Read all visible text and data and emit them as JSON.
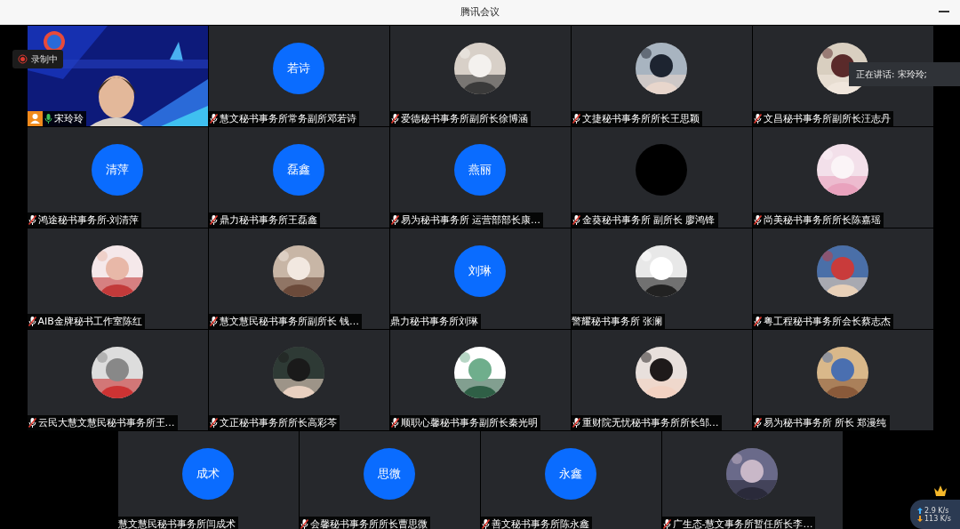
{
  "window": {
    "title": "腾讯会议"
  },
  "recording": {
    "label": "录制中"
  },
  "speaking": {
    "label": "正在讲话: 宋玲玲;"
  },
  "rows": [
    [
      {
        "kind": "video",
        "name": "宋玲玲",
        "mic_muted": false
      },
      {
        "kind": "initials",
        "initials": "若诗",
        "name": "慧文秘书事务所常务副所邓若诗",
        "mic_muted": true
      },
      {
        "name": "爱德秘书事务所副所长徐博涵",
        "mic_muted": true
      },
      {
        "name": "文捷秘书事务所所长王思颖",
        "mic_muted": true
      },
      {
        "name": "文昌秘书事务所副所长汪志丹",
        "mic_muted": true
      }
    ],
    [
      {
        "kind": "initials",
        "initials": "清萍",
        "name": "鸿途秘书事务所-刘清萍",
        "mic_muted": true
      },
      {
        "kind": "initials",
        "initials": "磊鑫",
        "name": "鼎力秘书事务所王磊鑫",
        "mic_muted": true
      },
      {
        "kind": "initials",
        "initials": "燕丽",
        "name": "易为秘书事务所 运营部部长康…",
        "mic_muted": true
      },
      {
        "kind": "blank",
        "name": "金葵秘书事务所 副所长 廖鸿锋",
        "mic_muted": true
      },
      {
        "name": "尚美秘书事务所所长陈嘉瑶",
        "mic_muted": true
      }
    ],
    [
      {
        "name": "AIB金牌秘书工作室陈红",
        "mic_muted": true
      },
      {
        "name": "慧文慧民秘书事务所副所长 钱…",
        "mic_muted": true
      },
      {
        "kind": "initials",
        "initials": "刘琳",
        "name": "鼎力秘书事务所刘琳"
      },
      {
        "name": "警耀秘书事务所  张澜"
      },
      {
        "name": "粤工程秘书事务所会长蔡志杰",
        "mic_muted": true
      }
    ],
    [
      {
        "name": "云民大慧文慧民秘书事务所王…",
        "mic_muted": true
      },
      {
        "name": "文正秘书事务所所长高彩芩",
        "mic_muted": true
      },
      {
        "name": "顺职心馨秘书事务副所长秦光明",
        "mic_muted": true
      },
      {
        "name": "重财院无忧秘书事务所所长邹…",
        "mic_muted": true
      },
      {
        "name": "易为秘书事务所 所长 郑漫纯",
        "mic_muted": true
      }
    ],
    [
      {
        "kind": "initials",
        "initials": "成术",
        "name": "慧文慧民秘书事务所闫成术"
      },
      {
        "kind": "initials",
        "initials": "思微",
        "name": "会馨秘书事务所所长曹思微",
        "mic_muted": true
      },
      {
        "kind": "initials",
        "initials": "永鑫",
        "name": "善文秘书事务所陈永鑫",
        "mic_muted": true
      },
      {
        "name": "广生态-慧文事务所暂任所长李…",
        "mic_muted": true
      }
    ]
  ],
  "network": {
    "upload": "2.9 K/s",
    "download": "113 K/s"
  }
}
